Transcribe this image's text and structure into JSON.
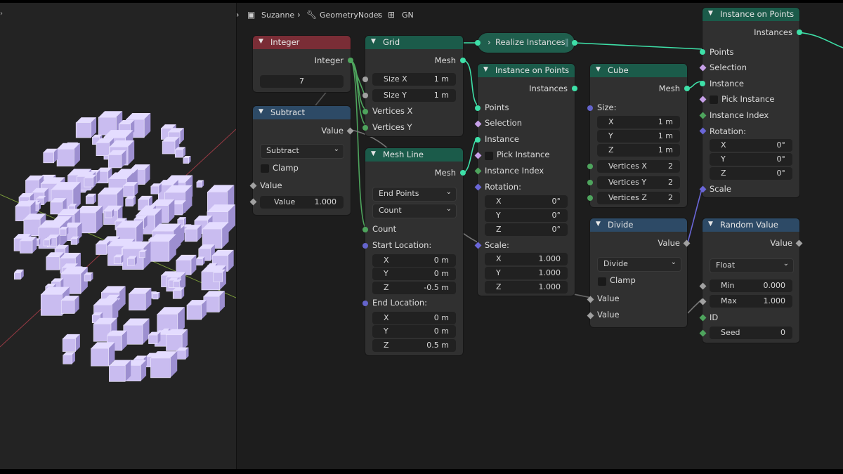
{
  "breadcrumb": {
    "object": "Suzanne",
    "modifier": "GeometryNodes",
    "tree": "GN"
  },
  "nodes": {
    "integer": {
      "title": "Integer",
      "output": "Integer",
      "value": "7"
    },
    "subtract": {
      "title": "Subtract",
      "output": "Value",
      "operation": "Subtract",
      "clamp": "Clamp",
      "input1": "Value",
      "input2_label": "Value",
      "input2_value": "1.000"
    },
    "grid": {
      "title": "Grid",
      "output": "Mesh",
      "size_x_label": "Size X",
      "size_x_value": "1 m",
      "size_y_label": "Size Y",
      "size_y_value": "1 m",
      "vertices_x": "Vertices X",
      "vertices_y": "Vertices Y"
    },
    "realize": {
      "title": "Realize Instances"
    },
    "instance1": {
      "title": "Instance on Points",
      "output": "Instances",
      "points": "Points",
      "selection": "Selection",
      "instance": "Instance",
      "pick_instance": "Pick Instance",
      "instance_index": "Instance Index",
      "rotation": "Rotation:",
      "rot_x": "X",
      "rot_x_v": "0°",
      "rot_y": "Y",
      "rot_y_v": "0°",
      "rot_z": "Z",
      "rot_z_v": "0°",
      "scale": "Scale:",
      "sc_x": "X",
      "sc_x_v": "1.000",
      "sc_y": "Y",
      "sc_y_v": "1.000",
      "sc_z": "Z",
      "sc_z_v": "1.000"
    },
    "meshline": {
      "title": "Mesh Line",
      "output": "Mesh",
      "mode": "End Points",
      "count_mode": "Count",
      "count": "Count",
      "start": "Start Location:",
      "s_x": "X",
      "s_x_v": "0 m",
      "s_y": "Y",
      "s_y_v": "0 m",
      "s_z": "Z",
      "s_z_v": "-0.5 m",
      "end": "End Location:",
      "e_x": "X",
      "e_x_v": "0 m",
      "e_y": "Y",
      "e_y_v": "0 m",
      "e_z": "Z",
      "e_z_v": "0.5 m"
    },
    "cube": {
      "title": "Cube",
      "output": "Mesh",
      "size": "Size:",
      "sz_x": "X",
      "sz_x_v": "1 m",
      "sz_y": "Y",
      "sz_y_v": "1 m",
      "sz_z": "Z",
      "sz_z_v": "1 m",
      "vx": "Vertices X",
      "vx_v": "2",
      "vy": "Vertices Y",
      "vy_v": "2",
      "vz": "Vertices Z",
      "vz_v": "2"
    },
    "divide": {
      "title": "Divide",
      "output": "Value",
      "operation": "Divide",
      "clamp": "Clamp",
      "input1": "Value",
      "input2": "Value"
    },
    "instance2": {
      "title": "Instance on Points",
      "output": "Instances",
      "points": "Points",
      "selection": "Selection",
      "instance": "Instance",
      "pick_instance": "Pick Instance",
      "instance_index": "Instance Index",
      "rotation": "Rotation:",
      "rot_x": "X",
      "rot_x_v": "0°",
      "rot_y": "Y",
      "rot_y_v": "0°",
      "rot_z": "Z",
      "rot_z_v": "0°",
      "scale": "Scale"
    },
    "random": {
      "title": "Random Value",
      "output": "Value",
      "type": "Float",
      "min_label": "Min",
      "min_value": "0.000",
      "max_label": "Max",
      "max_value": "1.000",
      "id": "ID",
      "seed_label": "Seed",
      "seed_value": "0"
    }
  },
  "colors": {
    "geometry_header": "#1b5b4a",
    "input_header": "#7a2d36",
    "converter_header": "#2d4a66",
    "geometry_socket": "#3ee0a8",
    "cube_color": "#c9bcf0"
  }
}
